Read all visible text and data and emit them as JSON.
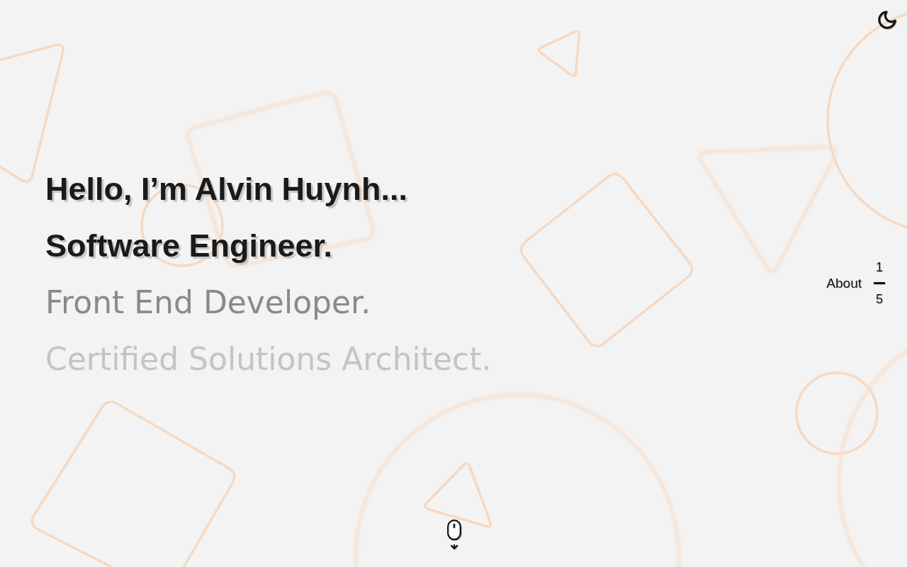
{
  "intro": {
    "lines": [
      {
        "text": "Hello, I’m Alvin Huynh...",
        "kind": "strong"
      },
      {
        "text": "Software Engineer.",
        "kind": "strong"
      },
      {
        "text": "Front End Developer.",
        "kind": "dim"
      },
      {
        "text": "Certified Solutions Architect.",
        "kind": "faint"
      }
    ]
  },
  "section_nav": {
    "label": "About",
    "current": "1",
    "total": "5"
  }
}
